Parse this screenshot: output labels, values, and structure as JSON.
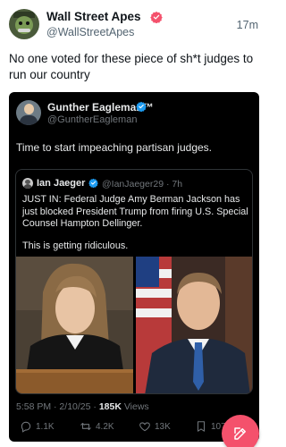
{
  "post": {
    "author_name": "Wall Street Apes",
    "author_handle": "@WallStreetApes",
    "time": "17m",
    "text": "No one voted for these piece of sh*t judges to run our country",
    "avatar_icon": "ape-avatar",
    "verified_color": "#f4516c"
  },
  "embedded": {
    "author_name": "Gunther Eagleman™",
    "author_handle": "@GuntherEagleman",
    "text": "Time to start impeaching partisan judges.",
    "verified_color": "#1d9bf0",
    "quoted": {
      "author_name": "Ian Jaeger",
      "author_handle": "@IanJaeger29 · 7h",
      "text": "JUST IN: Federal Judge Amy Berman Jackson has just blocked President  Trump from firing U.S. Special Counsel Hampton Dellinger.",
      "text2": "This is getting ridiculous.",
      "images": [
        "judge-photo",
        "counsel-photo"
      ]
    },
    "meta_time": "5:58 PM · 2/10/25 · ",
    "meta_views_count": "185K",
    "meta_views_label": " Views",
    "actions": {
      "replies": "1.1K",
      "reposts": "4.2K",
      "likes": "13K",
      "bookmarks": "107"
    }
  },
  "compose_button": {
    "icon": "compose-icon",
    "color": "#f4516c"
  }
}
